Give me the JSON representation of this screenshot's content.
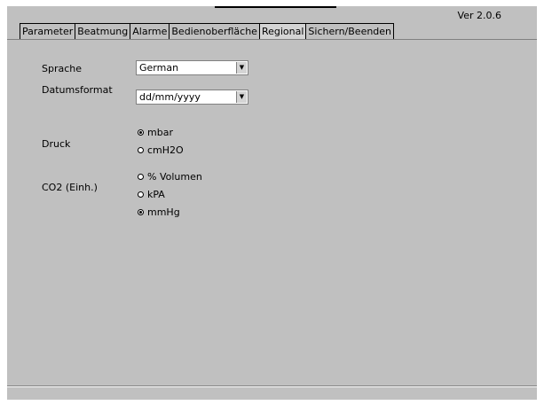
{
  "version": "Ver 2.0.6",
  "tabs": [
    {
      "label": "Parameter",
      "active": false
    },
    {
      "label": "Beatmung",
      "active": false
    },
    {
      "label": "Alarme",
      "active": false
    },
    {
      "label": "Bedienoberfläche",
      "active": false
    },
    {
      "label": "Regional",
      "active": true
    },
    {
      "label": "Sichern/Beenden",
      "active": false
    }
  ],
  "language": {
    "label": "Sprache",
    "value": "German"
  },
  "date_format": {
    "label": "Datumsformat",
    "value": "dd/mm/yyyy"
  },
  "pressure": {
    "label": "Druck",
    "options": [
      {
        "label": "mbar",
        "selected": true
      },
      {
        "label": "cmH2O",
        "selected": false
      }
    ]
  },
  "co2": {
    "label": "CO2 (Einh.)",
    "options": [
      {
        "label": "% Volumen",
        "selected": false
      },
      {
        "label": "kPA",
        "selected": false
      },
      {
        "label": "mmHg",
        "selected": true
      }
    ]
  },
  "colors": {
    "panel": "#c0c0c0",
    "active_tab": "#d4d4d4"
  }
}
